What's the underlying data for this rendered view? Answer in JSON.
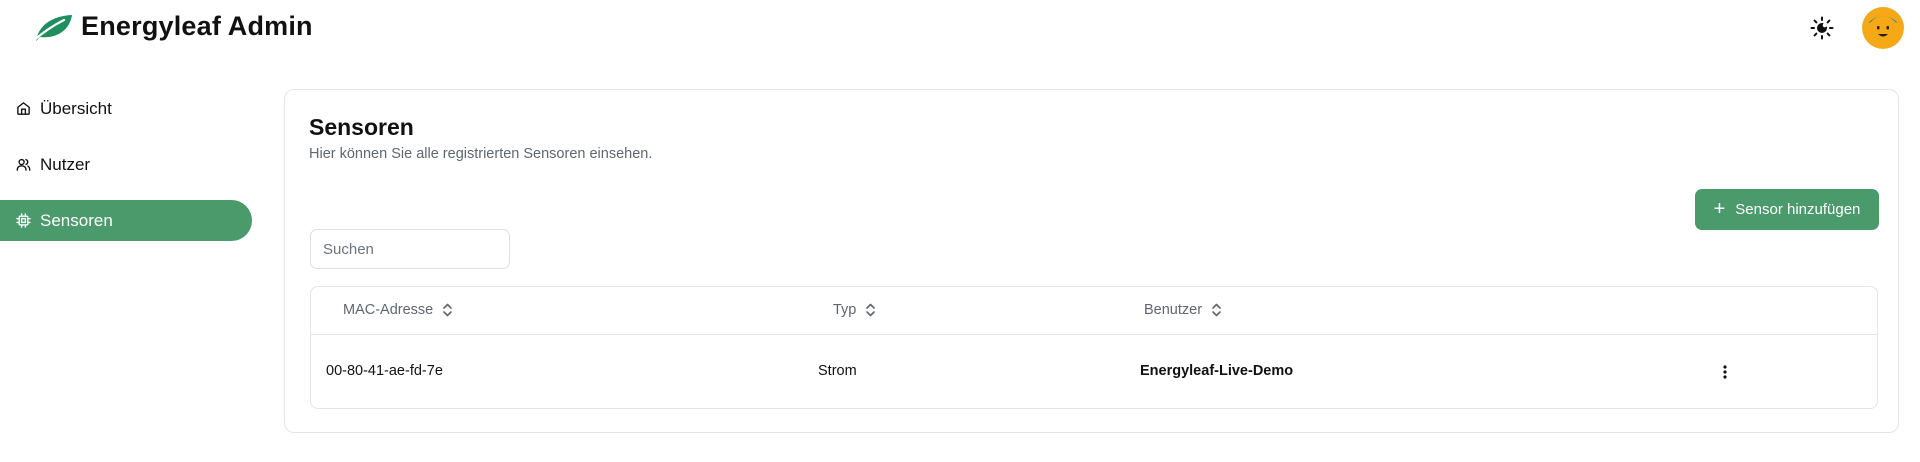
{
  "header": {
    "title": "Energyleaf Admin",
    "logo_icon": "leaf-icon",
    "theme_toggle_icon": "sun-moon-icon",
    "avatar_icon": "smiley-avatar",
    "brand_color": "#4a9a6b"
  },
  "sidebar": {
    "items": [
      {
        "label": "Übersicht",
        "icon": "home-icon",
        "active": false
      },
      {
        "label": "Nutzer",
        "icon": "users-icon",
        "active": false
      },
      {
        "label": "Sensoren",
        "icon": "cpu-icon",
        "active": true
      }
    ]
  },
  "main": {
    "title": "Sensoren",
    "subtitle": "Hier können Sie alle registrierten Sensoren einsehen.",
    "add_button_label": "Sensor hinzufügen",
    "search": {
      "placeholder": "Suchen",
      "value": ""
    },
    "table": {
      "columns": [
        "MAC-Adresse",
        "Typ",
        "Benutzer"
      ],
      "rows": [
        {
          "mac": "00-80-41-ae-fd-7e",
          "type": "Strom",
          "user": "Energyleaf-Live-Demo"
        }
      ]
    }
  }
}
